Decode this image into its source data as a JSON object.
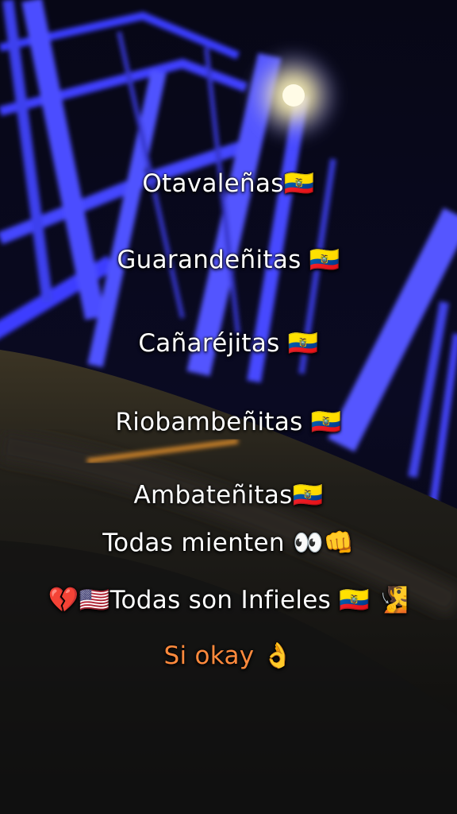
{
  "overlay": {
    "lines": [
      "Otavaleñas🇪🇨",
      "Guarandeñitas 🇪🇨",
      "Cañaréjitas 🇪🇨",
      "Riobambeñitas 🇪🇨",
      "Ambateñitas🇪🇨",
      "Todas mienten 👀👊",
      "💔🇺🇸Todas son Infieles 🇪🇨 🧏",
      "Si okay 👌"
    ]
  },
  "colors": {
    "text": "#ffffff",
    "accent_text": "#ff8a3d",
    "bridge_light": "#4a4cff",
    "night_sky": "#04040c"
  }
}
